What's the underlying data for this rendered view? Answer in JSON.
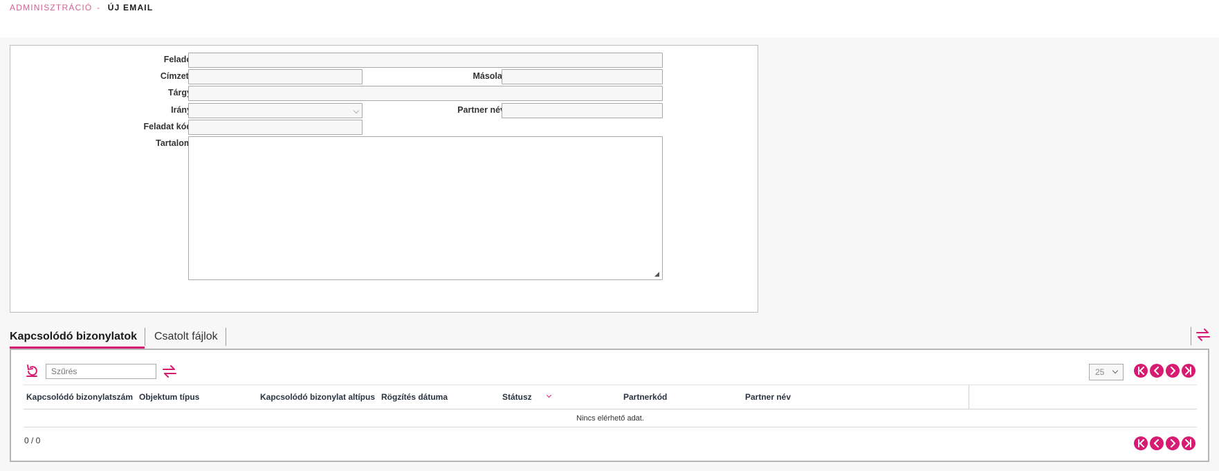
{
  "breadcrumb": {
    "parent": "ADMINISZTRÁCIÓ",
    "separator": "-",
    "current": "ÚJ EMAIL"
  },
  "form": {
    "sender": {
      "label": "Feladó",
      "value": ""
    },
    "recipient": {
      "label": "Címzett",
      "value": ""
    },
    "cc": {
      "label": "Másolat",
      "value": ""
    },
    "subject": {
      "label": "Tárgy",
      "value": ""
    },
    "direction": {
      "label": "Irány",
      "value": ""
    },
    "partner_name": {
      "label": "Partner név",
      "value": ""
    },
    "task_code": {
      "label": "Feladat kód",
      "value": ""
    },
    "content": {
      "label": "Tartalom",
      "value": ""
    }
  },
  "tabs": [
    {
      "label": "Kapcsolódó bizonylatok",
      "active": true
    },
    {
      "label": "Csatolt fájlok",
      "active": false
    }
  ],
  "grid": {
    "filter_placeholder": "Szűrés",
    "page_size": "25",
    "columns": [
      "Kapcsolódó bizonylatszám",
      "Objektum típus",
      "Kapcsolódó bizonylat altípus",
      "Rögzítés dátuma",
      "Státusz",
      "Partnerkód",
      "Partner név"
    ],
    "empty_text": "Nincs elérhető adat.",
    "count_text": "0 / 0"
  },
  "icons": {
    "refresh": "refresh-icon",
    "swap": "swap-arrows-icon",
    "pager": [
      "first-page-icon",
      "prev-page-icon",
      "next-page-icon",
      "last-page-icon"
    ]
  },
  "colors": {
    "accent": "#d81b72",
    "breadcrumb_parent": "#d1628f"
  }
}
